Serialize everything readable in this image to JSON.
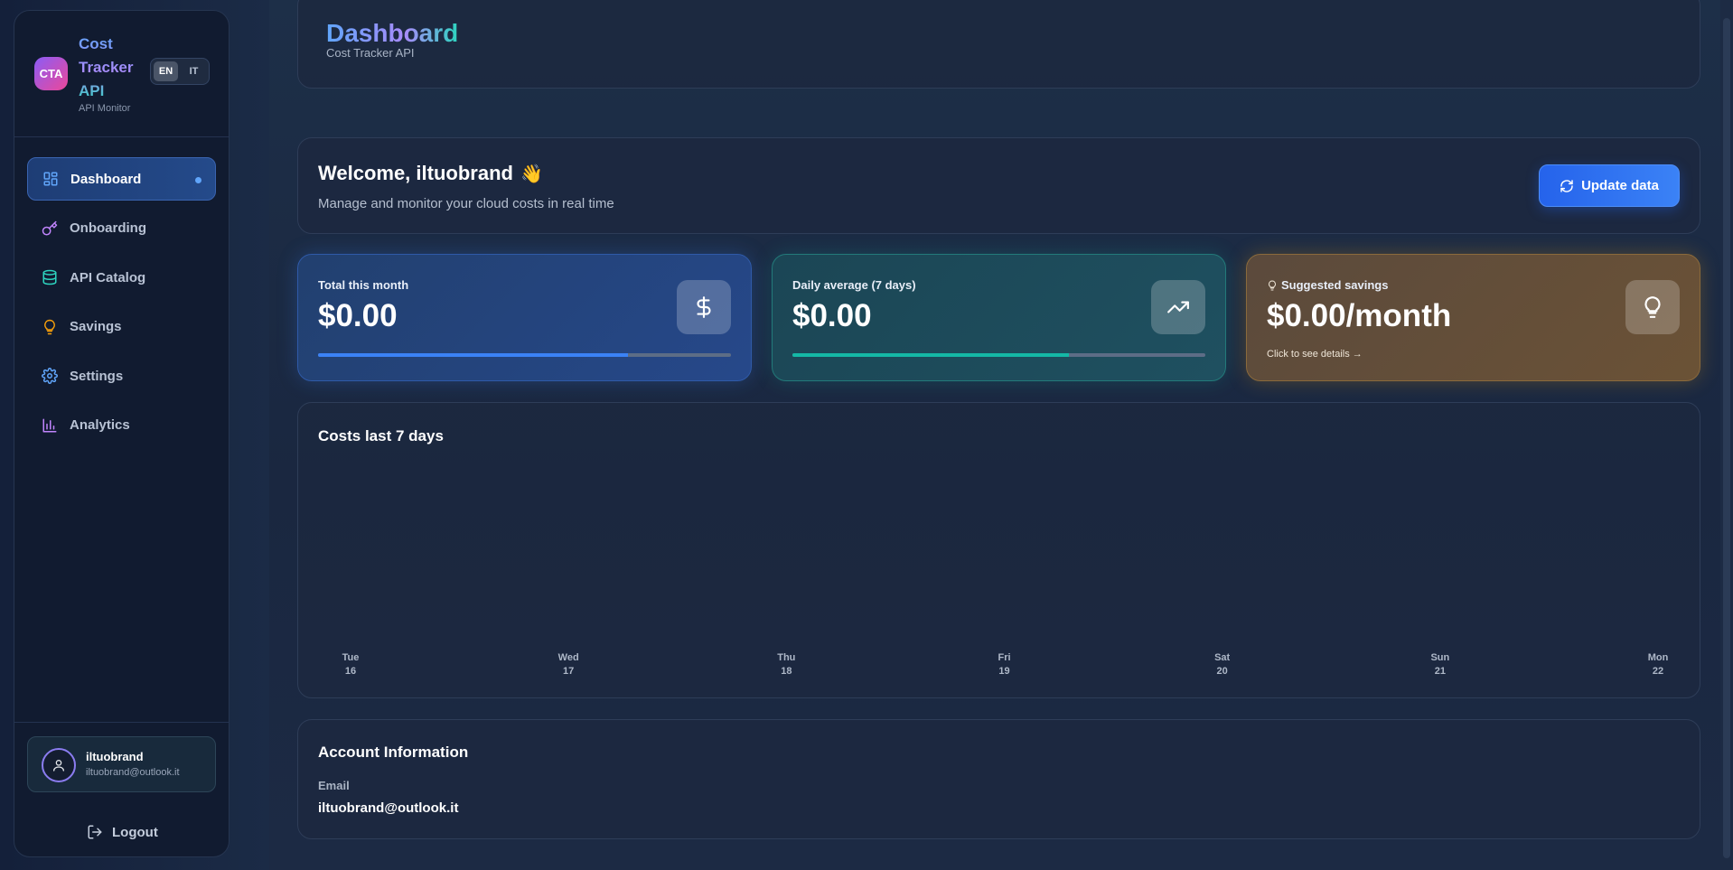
{
  "sidebar": {
    "logo_text": "CTA",
    "brand_title": "Cost Tracker API",
    "brand_subtitle": "API Monitor",
    "languages": [
      "EN",
      "IT"
    ],
    "active_language": "EN",
    "items": [
      {
        "label": "Dashboard",
        "icon": "dashboard-icon",
        "color": "#60a5fa",
        "active": true
      },
      {
        "label": "Onboarding",
        "icon": "key-icon",
        "color": "#c084fc"
      },
      {
        "label": "API Catalog",
        "icon": "database-icon",
        "color": "#2dd4bf"
      },
      {
        "label": "Savings",
        "icon": "lightbulb-icon",
        "color": "#f59e0b"
      },
      {
        "label": "Settings",
        "icon": "gear-icon",
        "color": "#60a5fa"
      },
      {
        "label": "Analytics",
        "icon": "bar-chart-icon",
        "color": "#c084fc"
      }
    ],
    "user": {
      "name": "iltuobrand",
      "email": "iltuobrand@outlook.it"
    },
    "logout_label": "Logout"
  },
  "header": {
    "title": "Dashboard",
    "subtitle": "Cost Tracker API"
  },
  "welcome": {
    "title": "Welcome, iltuobrand",
    "emoji": "👋",
    "subtitle": "Manage and monitor your cloud costs in real time",
    "update_label": "Update data"
  },
  "stats": [
    {
      "label": "Total this month",
      "value": "$0.00",
      "progress": 0.75
    },
    {
      "label": "Daily average (7 days)",
      "value": "$0.00",
      "progress": 0.67
    },
    {
      "label": "Suggested savings",
      "value": "$0.00/month",
      "link": "Click to see details →"
    }
  ],
  "chart_data": {
    "type": "bar",
    "title": "Costs last 7 days",
    "categories": [
      {
        "day": "Tue",
        "date": "16"
      },
      {
        "day": "Wed",
        "date": "17"
      },
      {
        "day": "Thu",
        "date": "18"
      },
      {
        "day": "Fri",
        "date": "19"
      },
      {
        "day": "Sat",
        "date": "20"
      },
      {
        "day": "Sun",
        "date": "21"
      },
      {
        "day": "Mon",
        "date": "22"
      }
    ],
    "values": [
      0,
      0,
      0,
      0,
      0,
      0,
      0
    ],
    "grid": false
  },
  "account": {
    "title": "Account Information",
    "email_label": "Email",
    "email_value": "iltuobrand@outlook.it"
  }
}
